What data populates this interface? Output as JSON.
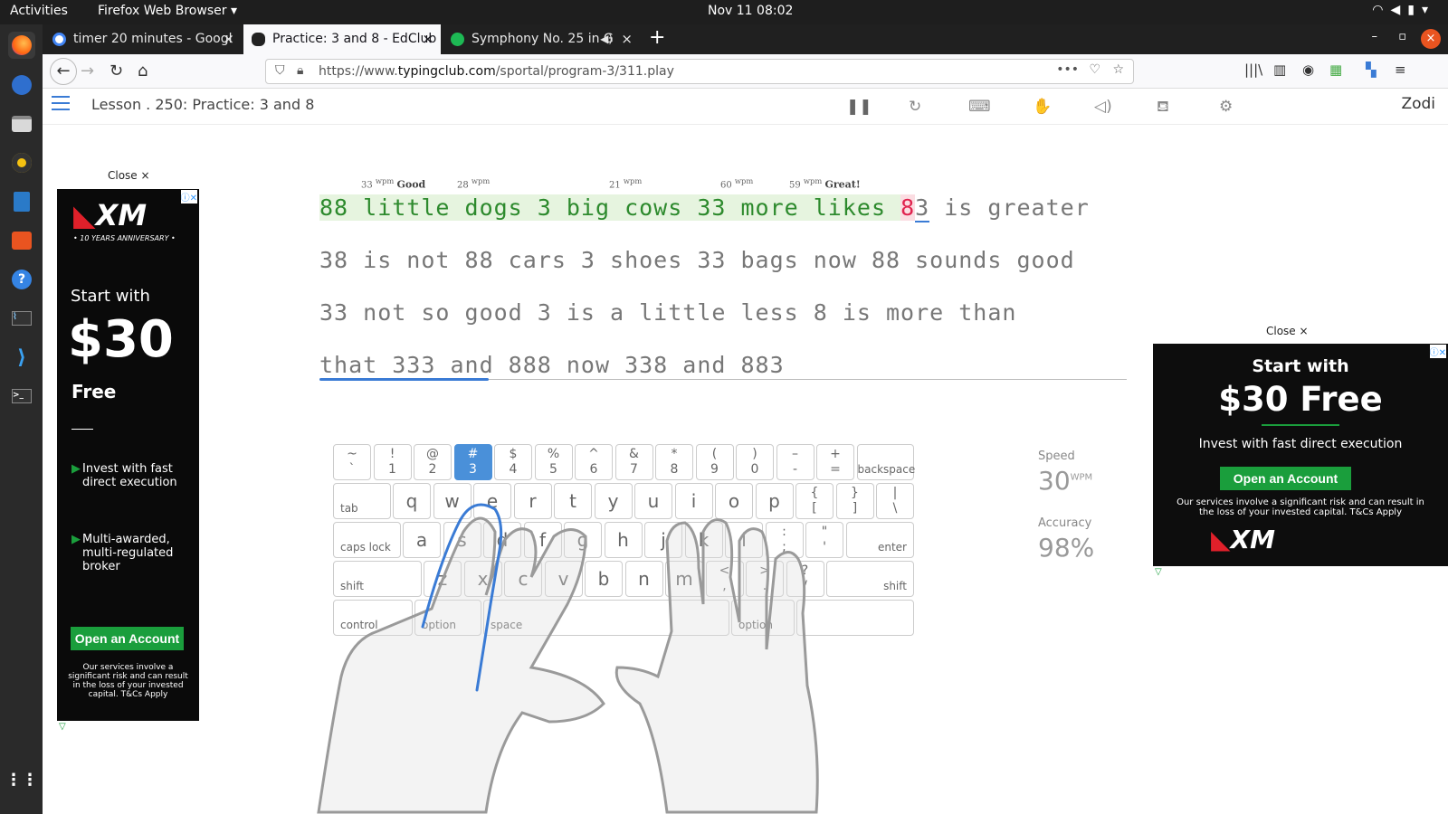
{
  "os": {
    "activities": "Activities",
    "app_menu": "Firefox Web Browser",
    "clock": "Nov 11  08:02"
  },
  "tabs": [
    {
      "title": "timer 20 minutes - Googl",
      "close": "×"
    },
    {
      "title": "Practice: 3 and 8 - EdClub",
      "close": "×"
    },
    {
      "title": "Symphony No. 25 in G",
      "close": "×"
    }
  ],
  "new_tab": "+",
  "url": {
    "prefix": "https://www.",
    "domain": "typingclub.com",
    "path": "/sportal/program-3/311.play"
  },
  "lesson": {
    "title": "Lesson . 250: Practice: 3 and 8",
    "user": "Zodi"
  },
  "wpm_marks": [
    {
      "value": "33",
      "unit": "wpm",
      "tag": "Good"
    },
    {
      "value": "28",
      "unit": "wpm",
      "tag": ""
    },
    {
      "value": "21",
      "unit": "wpm",
      "tag": ""
    },
    {
      "value": "60",
      "unit": "wpm",
      "tag": ""
    },
    {
      "value": "59",
      "unit": "wpm",
      "tag": "Great!"
    }
  ],
  "text": {
    "line1_done": "88 little dogs 3 big cows 33 more likes ",
    "line1_error": "8",
    "line1_cursor": "3",
    "line1_rest": " is greater",
    "line2": "38 is not 88 cars 3 shoes 33 bags now 88 sounds good",
    "line3": "33 not so good 3 is a little less 8 is more than",
    "line4": "that 333 and 888 now 338 and 883"
  },
  "progress": 0.21,
  "keyboard": {
    "row1": [
      [
        "~",
        "`"
      ],
      [
        "!",
        "1"
      ],
      [
        "@",
        "2"
      ],
      [
        "#",
        "3"
      ],
      [
        "$",
        "4"
      ],
      [
        "%",
        "5"
      ],
      [
        "^",
        "6"
      ],
      [
        "&",
        "7"
      ],
      [
        "*",
        "8"
      ],
      [
        "(",
        "9"
      ],
      [
        ")",
        "0"
      ],
      [
        "–",
        "-"
      ],
      [
        "+",
        "="
      ]
    ],
    "backspace": "backspace",
    "tab": "tab",
    "row2": [
      "q",
      "w",
      "e",
      "r",
      "t",
      "y",
      "u",
      "i",
      "o",
      "p"
    ],
    "row2sym": [
      [
        "{",
        "["
      ],
      [
        "}",
        "]"
      ],
      [
        "|",
        "\\"
      ]
    ],
    "caps": "caps lock",
    "row3": [
      "a",
      "s",
      "d",
      "f",
      "g",
      "h",
      "j",
      "k",
      "l"
    ],
    "row3sym": [
      [
        ":",
        ";"
      ],
      [
        "\"",
        "'"
      ]
    ],
    "enter": "enter",
    "shift": "shift",
    "row4": [
      "z",
      "x",
      "c",
      "v",
      "b",
      "n",
      "m"
    ],
    "row4sym": [
      [
        "<",
        ","
      ],
      [
        ">",
        "."
      ],
      [
        "?",
        "/"
      ]
    ],
    "control": "control",
    "option": "option",
    "space": "space",
    "highlight": "3"
  },
  "stats": {
    "speed_label": "Speed",
    "speed": "30",
    "speed_unit": "WPM",
    "accuracy_label": "Accuracy",
    "accuracy": "98%"
  },
  "ads": {
    "close": "Close ×",
    "left": {
      "brand": "XM",
      "anniv": "• 10 YEARS ANNIVERSARY •",
      "start": "Start with",
      "amount": "$30",
      "free": "Free",
      "b1": "Invest with fast direct execution",
      "b2": "Multi-awarded, multi-regulated broker",
      "cta": "Open an Account",
      "disclaimer": "Our services involve a significant risk and can result in the loss of your invested capital. T&Cs Apply"
    },
    "right": {
      "start": "Start with",
      "amount": "$30 Free",
      "sub": "Invest with fast direct execution",
      "cta": "Open an Account",
      "disclaimer": "Our services involve a significant risk and can result in the loss of your invested capital. T&Cs Apply",
      "brand": "XM"
    }
  }
}
